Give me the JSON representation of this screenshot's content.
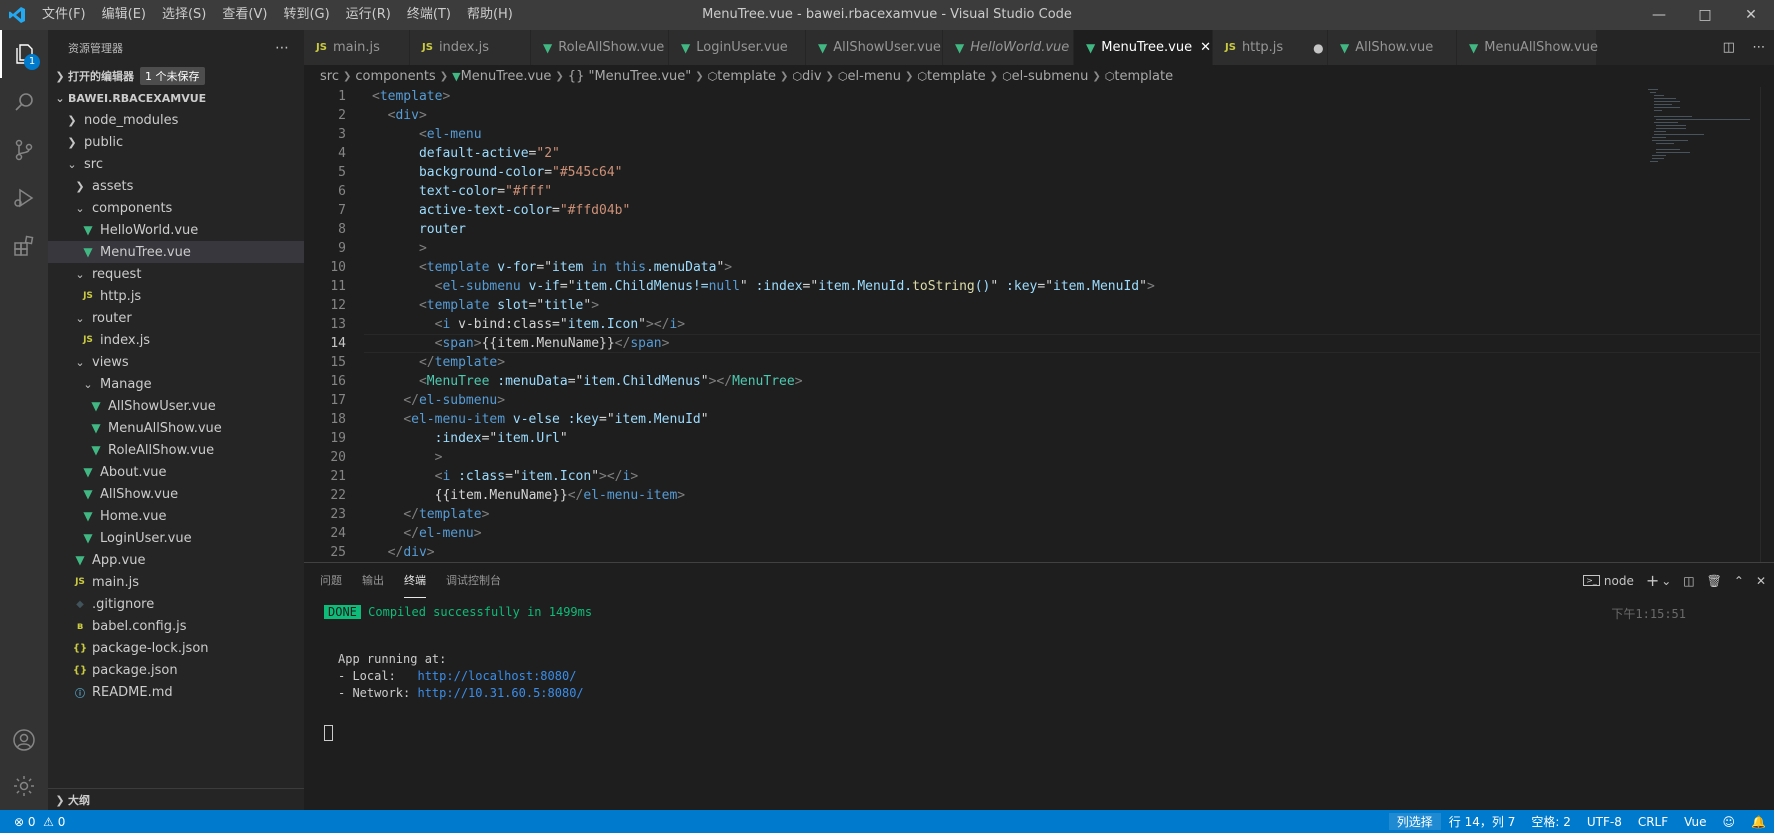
{
  "window": {
    "title": "MenuTree.vue - bawei.rbacexamvue - Visual Studio Code",
    "menu": [
      "文件(F)",
      "编辑(E)",
      "选择(S)",
      "查看(V)",
      "转到(G)",
      "运行(R)",
      "终端(T)",
      "帮助(H)"
    ]
  },
  "activity": {
    "explorer_badge": "1"
  },
  "sidebar": {
    "title": "资源管理器",
    "open_editors": "打开的编辑器",
    "unsaved": "1 个未保存",
    "project": "BAWEI.RBACEXAMVUE",
    "outline": "大纲",
    "tree": [
      {
        "label": "node_modules",
        "icon": "chevron-right",
        "type": "folder"
      },
      {
        "label": "public",
        "icon": "chevron-right",
        "type": "folder"
      },
      {
        "label": "src",
        "icon": "chevron-down",
        "type": "folder"
      },
      {
        "label": "assets",
        "icon": "chevron-right",
        "type": "folder"
      },
      {
        "label": "components",
        "icon": "chevron-down",
        "type": "folder"
      },
      {
        "label": "HelloWorld.vue",
        "icon": "vue",
        "type": "file"
      },
      {
        "label": "MenuTree.vue",
        "icon": "vue",
        "type": "file"
      },
      {
        "label": "request",
        "icon": "chevron-down",
        "type": "folder"
      },
      {
        "label": "http.js",
        "icon": "js",
        "type": "file"
      },
      {
        "label": "router",
        "icon": "chevron-down",
        "type": "folder"
      },
      {
        "label": "index.js",
        "icon": "js",
        "type": "file"
      },
      {
        "label": "views",
        "icon": "chevron-down",
        "type": "folder"
      },
      {
        "label": "Manage",
        "icon": "chevron-down",
        "type": "folder"
      },
      {
        "label": "AllShowUser.vue",
        "icon": "vue",
        "type": "file"
      },
      {
        "label": "MenuAllShow.vue",
        "icon": "vue",
        "type": "file"
      },
      {
        "label": "RoleAllShow.vue",
        "icon": "vue",
        "type": "file"
      },
      {
        "label": "About.vue",
        "icon": "vue",
        "type": "file"
      },
      {
        "label": "AllShow.vue",
        "icon": "vue",
        "type": "file"
      },
      {
        "label": "Home.vue",
        "icon": "vue",
        "type": "file"
      },
      {
        "label": "LoginUser.vue",
        "icon": "vue",
        "type": "file"
      },
      {
        "label": "App.vue",
        "icon": "vue",
        "type": "file"
      },
      {
        "label": "main.js",
        "icon": "js",
        "type": "file"
      },
      {
        "label": ".gitignore",
        "icon": "git",
        "type": "file"
      },
      {
        "label": "babel.config.js",
        "icon": "babel",
        "type": "file"
      },
      {
        "label": "package-lock.json",
        "icon": "json",
        "type": "file"
      },
      {
        "label": "package.json",
        "icon": "json",
        "type": "file"
      },
      {
        "label": "README.md",
        "icon": "info",
        "type": "file"
      }
    ]
  },
  "tabs": [
    {
      "label": "main.js",
      "icon": "JS"
    },
    {
      "label": "index.js",
      "icon": "JS"
    },
    {
      "label": "RoleAllShow.vue",
      "icon": "vue"
    },
    {
      "label": "LoginUser.vue",
      "icon": "vue"
    },
    {
      "label": "AllShowUser.vue",
      "icon": "vue"
    },
    {
      "label": "HelloWorld.vue",
      "icon": "vue"
    },
    {
      "label": "MenuTree.vue",
      "icon": "vue"
    },
    {
      "label": "http.js",
      "icon": "JS"
    },
    {
      "label": "AllShow.vue",
      "icon": "vue"
    },
    {
      "label": "MenuAllShow.vue",
      "icon": "vue"
    }
  ],
  "breadcrumb": [
    "src",
    "components",
    "MenuTree.vue",
    "{} \"MenuTree.vue\"",
    "template",
    "div",
    "el-menu",
    "template",
    "el-submenu",
    "template"
  ],
  "code": {
    "current_line": 14,
    "lines": [
      "<template>",
      "  <div>",
      "      <el-menu",
      "      default-active=\"2\"",
      "      background-color=\"#545c64\"",
      "      text-color=\"#fff\"",
      "      active-text-color=\"#ffd04b\"",
      "      router",
      "      >",
      "      <template v-for=\"item in this.menuData\">",
      "        <el-submenu v-if=\"item.ChildMenus!=null\" :index=\"item.MenuId.toString()\" :key=\"item.MenuId\">",
      "      <template slot=\"title\">",
      "        <i v-bind:class=\"item.Icon\"></i>",
      "        <span>{{item.MenuName}}</span>",
      "      </template>",
      "      <MenuTree :menuData=\"item.ChildMenus\"></MenuTree>",
      "    </el-submenu>",
      "    <el-menu-item v-else :key=\"item.MenuId\"",
      "        :index=\"item.Url\"",
      "        >",
      "        <i :class=\"item.Icon\"></i>",
      "        {{item.MenuName}}</el-menu-item>",
      "    </template>",
      "    </el-menu>",
      "  </div>"
    ]
  },
  "panel": {
    "tabs": [
      "问题",
      "输出",
      "终端",
      "调试控制台"
    ],
    "active_tab": "终端",
    "terminal_name": "node",
    "terminal": {
      "done": "DONE",
      "compiled": "Compiled successfully in 1499ms",
      "time": "下午1:15:51",
      "app_running": "App running at:",
      "local_label": "- Local:   ",
      "local_url": "http://localhost:8080/",
      "network_label": "- Network: ",
      "network_url": "http://10.31.60.5:8080/"
    }
  },
  "statusbar": {
    "errors": "0",
    "warnings": "0",
    "column_select": "列选择",
    "position": "行 14，列 7",
    "spaces": "空格: 2",
    "encoding": "UTF-8",
    "eol": "CRLF",
    "language": "Vue"
  },
  "colors": {
    "accent": "#007acc",
    "vue": "#41b883",
    "js": "#cbcb41",
    "terminal_done": "#0dbc79"
  }
}
